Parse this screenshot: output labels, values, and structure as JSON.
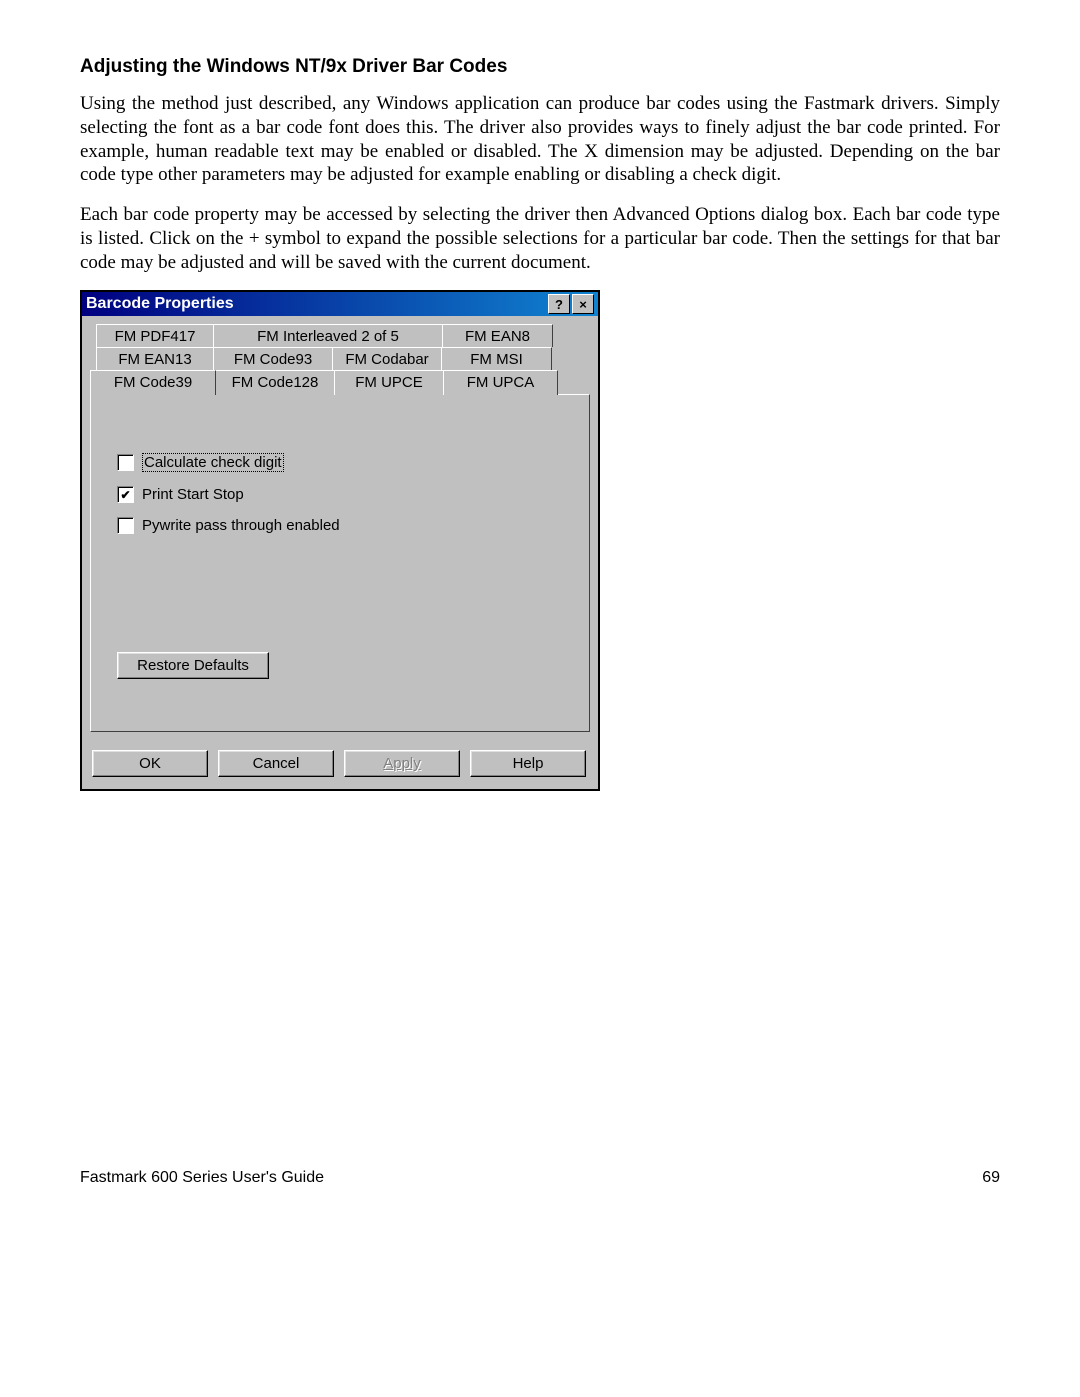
{
  "heading": "Adjusting the Windows NT/9x Driver Bar Codes",
  "para1": "Using the method just described, any Windows application can produce bar codes using the Fastmark drivers.  Simply selecting the font as a bar code font does this.  The driver also provides ways to finely adjust the bar code printed.  For example, human readable text may be enabled or disabled.  The X dimension may be adjusted.  Depending on the bar code type other parameters may be adjusted for example enabling or disabling a check digit.",
  "para2": "Each bar code property may be accessed by selecting the driver then Advanced Options dialog box.  Each bar code type is listed.  Click on the + symbol to expand the possible selections for a particular bar code.  Then the settings for that bar code may be adjusted and will be saved with the current document.",
  "dialog": {
    "title": "Barcode Properties",
    "help_glyph": "?",
    "close_glyph": "×",
    "tabs": {
      "row1": [
        "FM PDF417",
        "FM Interleaved 2 of 5",
        "FM EAN8"
      ],
      "row2": [
        "FM EAN13",
        "FM Code93",
        "FM Codabar",
        "FM MSI"
      ],
      "row3": [
        "FM Code39",
        "FM Code128",
        "FM UPCE",
        "FM UPCA"
      ]
    },
    "checkboxes": [
      {
        "label": "Calculate check digit",
        "checked": false,
        "focused": true
      },
      {
        "label": "Print Start Stop",
        "checked": true,
        "focused": false
      },
      {
        "label": "Pywrite pass through enabled",
        "checked": false,
        "focused": false
      }
    ],
    "restore_label": "Restore Defaults",
    "buttons": {
      "ok": "OK",
      "cancel": "Cancel",
      "apply": "Apply",
      "help": "Help"
    }
  },
  "footer": {
    "left": "Fastmark 600 Series User's Guide",
    "right": "69"
  }
}
